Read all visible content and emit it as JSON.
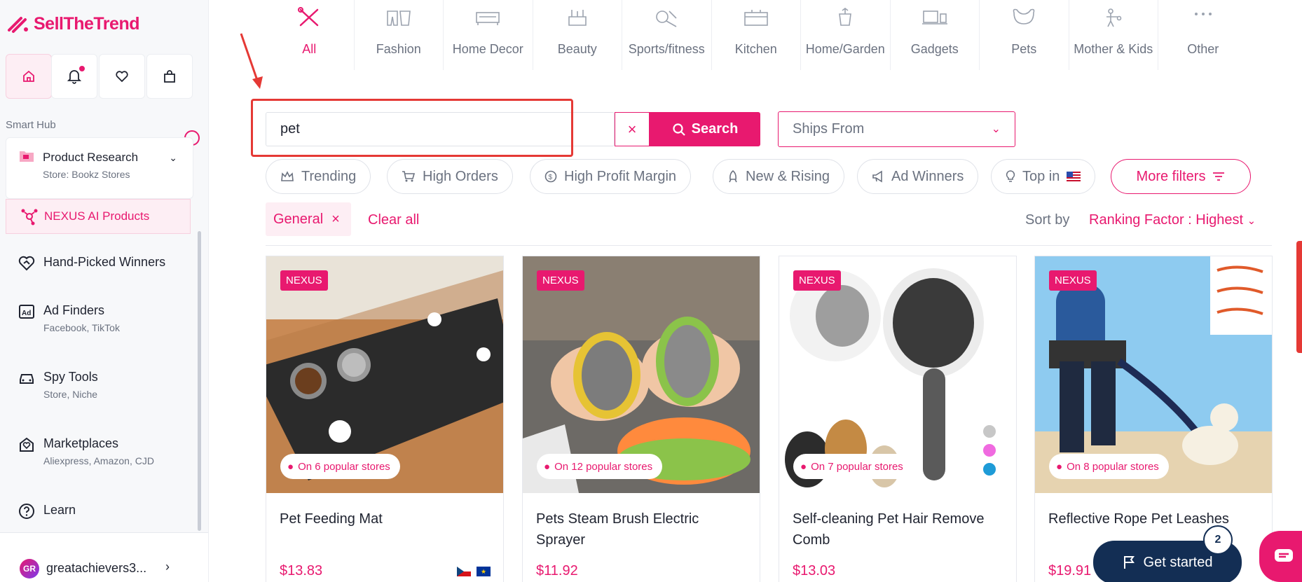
{
  "app": {
    "logo_text": "SellTheTrend"
  },
  "sidebar": {
    "section_label": "Smart Hub",
    "product_research": {
      "title": "Product Research",
      "subtitle": "Store: Bookz Stores"
    },
    "nexus": "NEXUS AI Products",
    "items": [
      {
        "title": "Hand-Picked Winners",
        "subtitle": ""
      },
      {
        "title": "Ad Finders",
        "subtitle": "Facebook, TikTok"
      },
      {
        "title": "Spy Tools",
        "subtitle": "Store, Niche"
      },
      {
        "title": "Marketplaces",
        "subtitle": "Aliexpress, Amazon, CJD"
      },
      {
        "title": "Learn",
        "subtitle": ""
      }
    ],
    "user": {
      "initials": "GR",
      "name": "greatachievers3..."
    }
  },
  "categories": [
    {
      "label": "All",
      "icon": "tools-icon",
      "active": true
    },
    {
      "label": "Fashion",
      "icon": "fashion-icon"
    },
    {
      "label": "Home Decor",
      "icon": "sofa-icon"
    },
    {
      "label": "Beauty",
      "icon": "beauty-icon"
    },
    {
      "label": "Sports/fitness",
      "icon": "sports-icon"
    },
    {
      "label": "Kitchen",
      "icon": "kitchen-icon"
    },
    {
      "label": "Home/Garden",
      "icon": "garden-icon"
    },
    {
      "label": "Gadgets",
      "icon": "gadgets-icon"
    },
    {
      "label": "Pets",
      "icon": "pets-icon"
    },
    {
      "label": "Mother & Kids",
      "icon": "kids-icon"
    },
    {
      "label": "Other",
      "icon": "more-icon"
    }
  ],
  "search": {
    "value": "pet",
    "clear": "×",
    "button": "Search",
    "ships_from": "Ships From"
  },
  "filters": {
    "trending": "Trending",
    "high_orders": "High Orders",
    "high_profit": "High Profit Margin",
    "new_rising": "New & Rising",
    "ad_winners": "Ad Winners",
    "top_in": "Top in",
    "more": "More filters"
  },
  "active_filter": {
    "label": "General",
    "remove": "×"
  },
  "clear_all": "Clear all",
  "sort": {
    "label": "Sort by",
    "value": "Ranking Factor : Highest"
  },
  "products": [
    {
      "badge": "NEXUS",
      "popularity": "On 6 popular stores",
      "title": "Pet Feeding Mat",
      "price": "$13.83"
    },
    {
      "badge": "NEXUS",
      "popularity": "On 12 popular stores",
      "title": "Pets Steam Brush Electric Sprayer",
      "price": "$11.92"
    },
    {
      "badge": "NEXUS",
      "popularity": "On 7 popular stores",
      "title": "Self-cleaning Pet Hair Remove Comb",
      "price": "$13.03"
    },
    {
      "badge": "NEXUS",
      "popularity": "On 8 popular stores",
      "title": "Reflective Rope Pet Leashes",
      "price": "$19.91"
    }
  ],
  "cta": {
    "label": "Get started",
    "count": "2"
  },
  "colors": {
    "brand": "#e8196f",
    "navy": "#132e54",
    "annotation": "#e53935"
  }
}
